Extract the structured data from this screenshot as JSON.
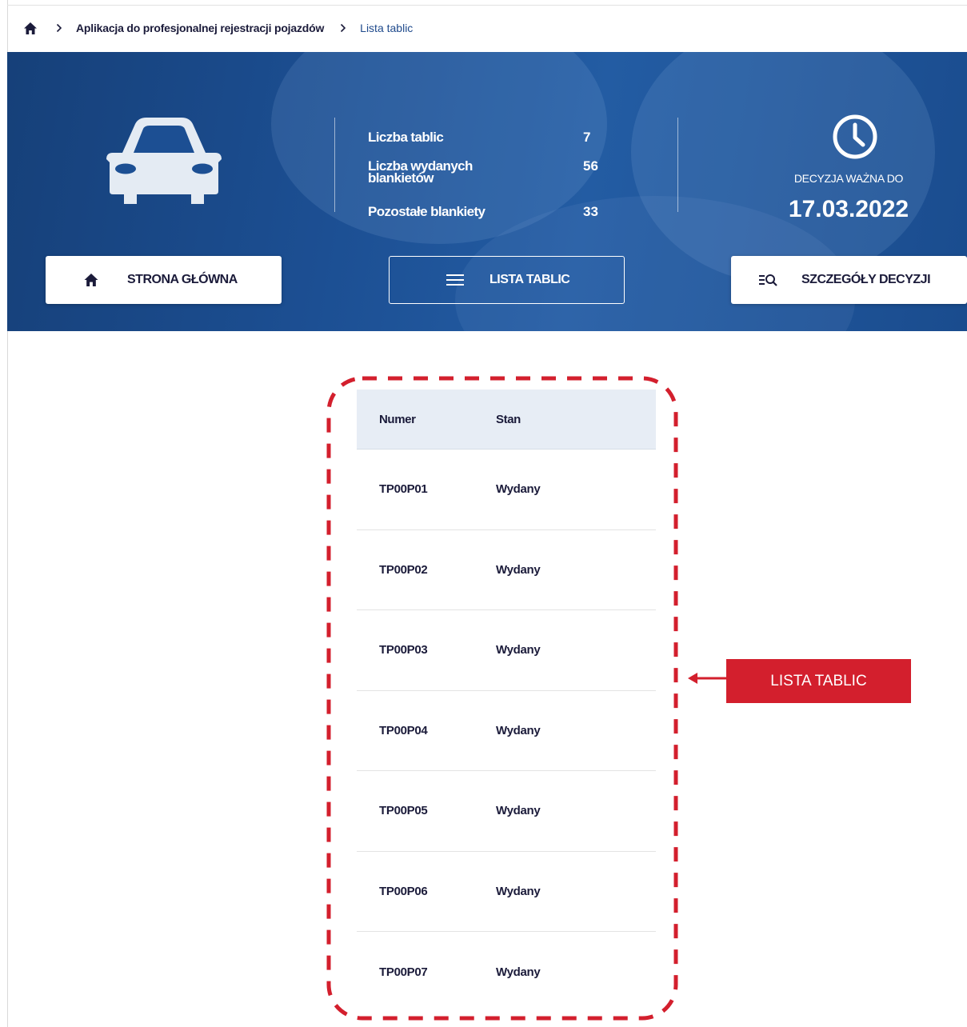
{
  "breadcrumb": {
    "app": "Aplikacja do profesjonalnej rejestracji pojazdów",
    "current": "Lista tablic"
  },
  "stats": {
    "plates_label": "Liczba tablic",
    "plates_value": "7",
    "issued_label": "Liczba wydanych blankietów",
    "issued_value": "56",
    "remaining_label": "Pozostałe blankiety",
    "remaining_value": "33"
  },
  "decision": {
    "label": "DECYZJA WAŻNA DO",
    "date": "17.03.2022"
  },
  "nav": {
    "home_label": "STRONA GŁÓWNA",
    "list_label": "LISTA TABLIC",
    "details_label": "SZCZEGÓŁY DECYZJI"
  },
  "table": {
    "headers": [
      "Numer",
      "Stan"
    ],
    "rows": [
      {
        "numer": "TP00P01",
        "stan": "Wydany"
      },
      {
        "numer": "TP00P02",
        "stan": "Wydany"
      },
      {
        "numer": "TP00P03",
        "stan": "Wydany"
      },
      {
        "numer": "TP00P04",
        "stan": "Wydany"
      },
      {
        "numer": "TP00P05",
        "stan": "Wydany"
      },
      {
        "numer": "TP00P06",
        "stan": "Wydany"
      },
      {
        "numer": "TP00P07",
        "stan": "Wydany"
      }
    ]
  },
  "annotation": {
    "label": "LISTA TABLIC",
    "color": "#d31f2d"
  },
  "colors": {
    "hero_blue": "#1c4f93",
    "dark_text": "#1b1b3a",
    "link_blue": "#1f4a8c"
  },
  "icons": {
    "breadcrumb_home": "home-icon",
    "breadcrumb_separator": "chevron-right-icon",
    "hero_car": "car-icon",
    "hero_clock": "clock-icon",
    "home_button": "home-icon",
    "list_button": "hamburger-menu-icon",
    "details_button": "list-search-icon",
    "annotation_arrow": "arrow-left-icon"
  }
}
